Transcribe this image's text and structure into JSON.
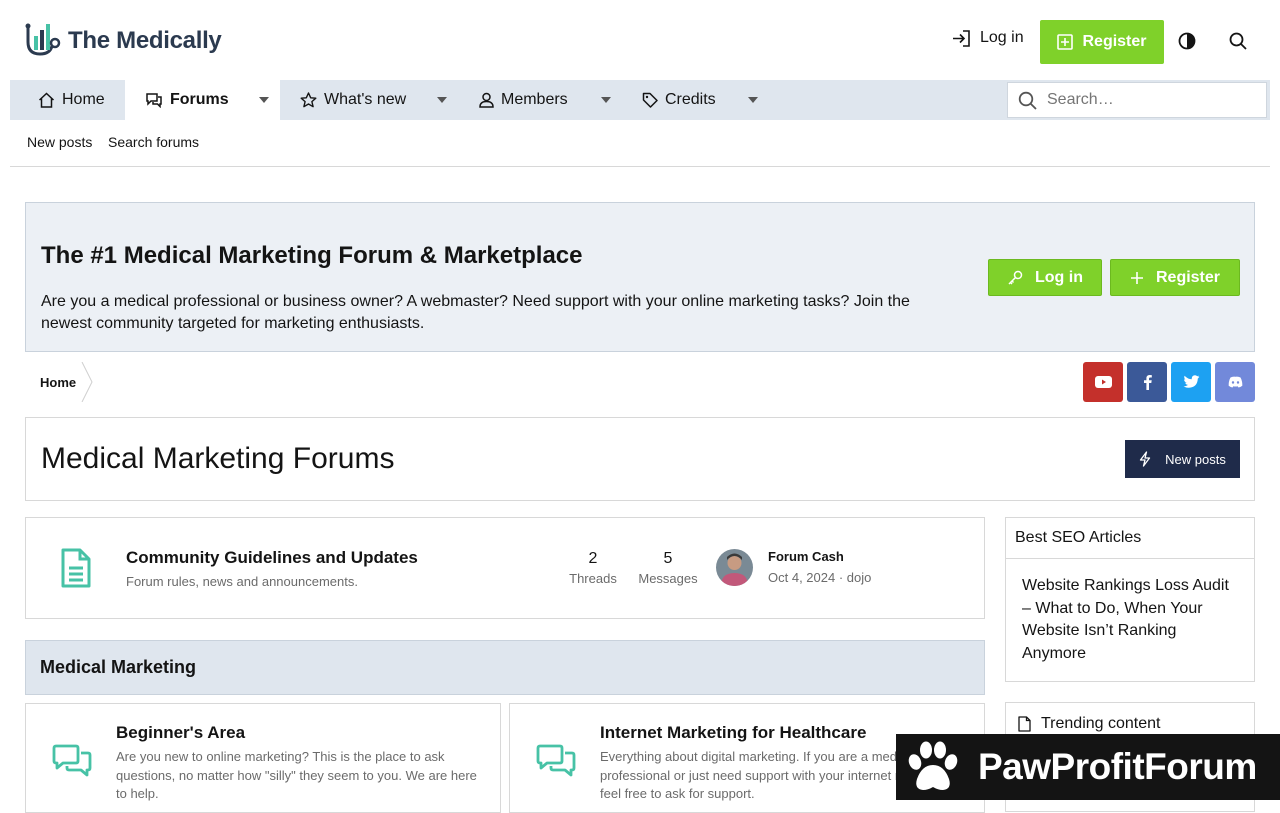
{
  "header": {
    "logo_text": "The Medically",
    "login_label": "Log in",
    "register_label": "Register"
  },
  "nav": {
    "tabs": [
      {
        "label": "Home",
        "icon": "home-icon"
      },
      {
        "label": "Forums",
        "icon": "comments-icon",
        "active": true
      },
      {
        "label": "What's new",
        "icon": "star-icon"
      },
      {
        "label": "Members",
        "icon": "user-icon"
      },
      {
        "label": "Credits",
        "icon": "tag-icon"
      }
    ],
    "search_placeholder": "Search…"
  },
  "subnav": {
    "items": [
      "New posts",
      "Search forums"
    ]
  },
  "notice": {
    "title": "The #1 Medical Marketing Forum & Marketplace",
    "text": "Are you a medical professional or business owner? A webmaster? Need support with your online marketing tasks? Join the newest community targeted for marketing enthusiasts.",
    "login_label": "Log in",
    "register_label": "Register"
  },
  "breadcrumb": {
    "home": "Home"
  },
  "social": [
    {
      "name": "youtube",
      "color": "#c4302b"
    },
    {
      "name": "facebook",
      "color": "#3b5998"
    },
    {
      "name": "twitter",
      "color": "#1da1f2"
    },
    {
      "name": "discord",
      "color": "#7289da"
    }
  ],
  "page": {
    "title": "Medical Marketing Forums",
    "new_posts_label": "New posts"
  },
  "forum": {
    "title": "Community Guidelines and Updates",
    "description": "Forum rules, news and announcements.",
    "threads": "2",
    "threads_label": "Threads",
    "messages": "5",
    "messages_label": "Messages",
    "last_post_title": "Forum Cash",
    "last_post_meta": "Oct 4, 2024 · dojo"
  },
  "category": {
    "title": "Medical Marketing",
    "subforums": [
      {
        "title": "Beginner's Area",
        "description": "Are you new to online marketing? This is the place to ask questions, no matter how \"silly\" they seem to you. We are here to help."
      },
      {
        "title": "Internet Marketing for Healthcare",
        "description": "Everything about digital marketing. If you are a medical professional or just need support with your internet marketing, feel free to ask for support."
      }
    ]
  },
  "sidebar": {
    "best_seo_title": "Best SEO Articles",
    "best_seo_link": "Website Rankings Loss Audit – What to Do, When Your Website Isn’t Ranking Anymore",
    "trending_title": "Trending content"
  },
  "overlay": {
    "brand": "PawProfitForum"
  },
  "colors": {
    "accent_green": "#7fd12a",
    "nav_bg": "#dfe6ee",
    "navy": "#1f2b4a",
    "forum_icon_teal": "#47c2a6"
  }
}
